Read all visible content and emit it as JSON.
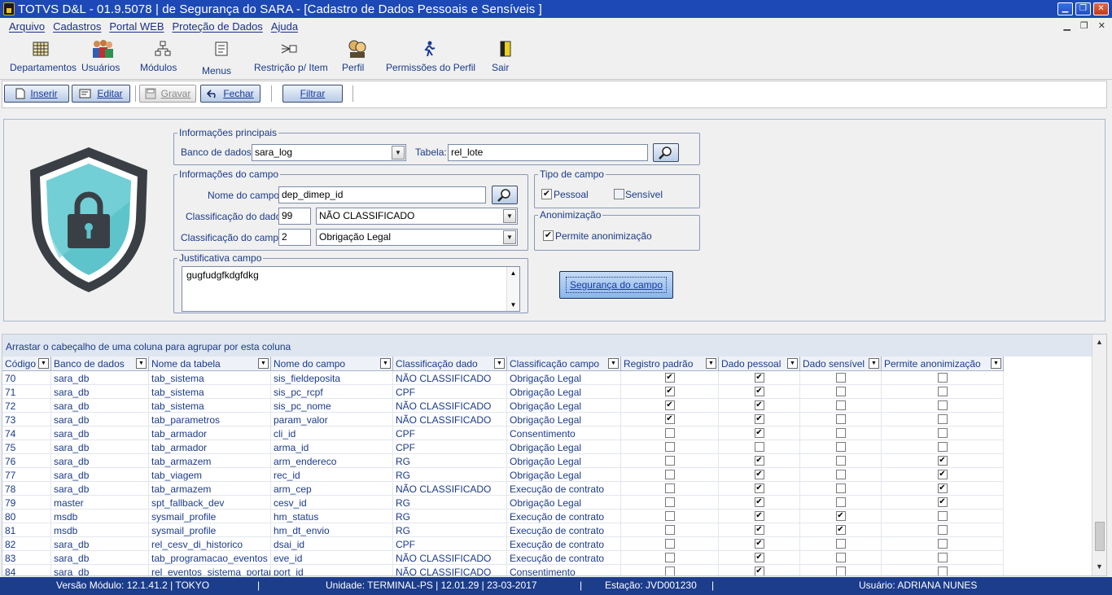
{
  "window": {
    "title": "TOTVS D&L - 01.9.5078 | de Segurança do SARA - [Cadastro de Dados Pessoais e Sensíveis ]"
  },
  "menu": [
    "Arquivo",
    "Cadastros",
    "Portal WEB",
    "Proteção de Dados",
    "Ajuda"
  ],
  "toolbar_big": [
    {
      "label": "Departamentos",
      "icon": "grid-icon"
    },
    {
      "label": "Usuários",
      "icon": "users-icon"
    },
    {
      "label": "Módulos",
      "icon": "modules-icon"
    },
    {
      "label": "Menus",
      "icon": "menus-icon"
    },
    {
      "label": "Restrição p/ Item",
      "icon": "restriction-icon"
    },
    {
      "label": "Perfil",
      "icon": "profile-icon"
    },
    {
      "label": "Permissões do Perfil",
      "icon": "permissions-icon"
    },
    {
      "label": "Sair",
      "icon": "exit-door-icon"
    }
  ],
  "actions": {
    "insert": "Inserir",
    "edit": "Editar",
    "save": "Gravar",
    "close": "Fechar",
    "filter": "Filtrar"
  },
  "form": {
    "main_group": "Informações principais",
    "db_label": "Banco de dados:",
    "db_value": "sara_log",
    "table_label": "Tabela:",
    "table_value": "rel_lote",
    "field_group": "Informações do campo",
    "field_name_label": "Nome do campo:",
    "field_name_value": "dep_dimep_id",
    "data_class_label": "Classificação do dado:",
    "data_class_code": "99",
    "data_class_value": "NÃO CLASSIFICADO",
    "field_class_label": "Classificação do campo:",
    "field_class_code": "2",
    "field_class_value": "Obrigação Legal",
    "type_group": "Tipo de campo",
    "type_personal": "Pessoal",
    "type_personal_checked": true,
    "type_sensitive": "Sensível",
    "type_sensitive_checked": false,
    "anon_group": "Anonimização",
    "anon_label": "Permite anonimização",
    "anon_checked": true,
    "justification_group": "Justificativa campo",
    "justification_value": "gugfudgfkdgfdkg",
    "security_button": "Segurança do campo"
  },
  "grid": {
    "group_hint": "Arrastar o cabeçalho de uma coluna para agrupar por esta coluna",
    "columns": [
      "Código",
      "Banco de dados",
      "Nome da tabela",
      "Nome do campo",
      "Classificação dado",
      "Classificação campo",
      "Registro padrão",
      "Dado pessoal",
      "Dado sensível",
      "Permite anonimização"
    ],
    "rows": [
      [
        "70",
        "sara_db",
        "tab_sistema",
        "sis_fieldeposita",
        "NÃO CLASSIFICADO",
        "Obrigação Legal",
        true,
        true,
        false,
        false
      ],
      [
        "71",
        "sara_db",
        "tab_sistema",
        "sis_pc_rcpf",
        "CPF",
        "Obrigação Legal",
        true,
        true,
        false,
        false
      ],
      [
        "72",
        "sara_db",
        "tab_sistema",
        "sis_pc_nome",
        "NÃO CLASSIFICADO",
        "Obrigação Legal",
        true,
        true,
        false,
        false
      ],
      [
        "73",
        "sara_db",
        "tab_parametros",
        "param_valor",
        "NÃO CLASSIFICADO",
        "Obrigação Legal",
        true,
        true,
        false,
        false
      ],
      [
        "74",
        "sara_db",
        "tab_armador",
        "cli_id",
        "CPF",
        "Consentimento",
        false,
        true,
        false,
        false
      ],
      [
        "75",
        "sara_db",
        "tab_armador",
        "arma_id",
        "CPF",
        "Obrigação Legal",
        false,
        false,
        false,
        false
      ],
      [
        "76",
        "sara_db",
        "tab_armazem",
        "arm_endereco",
        "RG",
        "Obrigação Legal",
        false,
        true,
        false,
        true
      ],
      [
        "77",
        "sara_db",
        "tab_viagem",
        "rec_id",
        "RG",
        "Obrigação Legal",
        false,
        true,
        false,
        true
      ],
      [
        "78",
        "sara_db",
        "tab_armazem",
        "arm_cep",
        "NÃO CLASSIFICADO",
        "Execução de contrato",
        false,
        true,
        false,
        true
      ],
      [
        "79",
        "master",
        "spt_fallback_dev",
        "cesv_id",
        "RG",
        "Obrigação Legal",
        false,
        true,
        false,
        true
      ],
      [
        "80",
        "msdb",
        "sysmail_profile",
        "hm_status",
        "RG",
        "Execução de contrato",
        false,
        true,
        true,
        false
      ],
      [
        "81",
        "msdb",
        "sysmail_profile",
        "hm_dt_envio",
        "RG",
        "Execução de contrato",
        false,
        true,
        true,
        false
      ],
      [
        "82",
        "sara_db",
        "rel_cesv_di_historico",
        "dsai_id",
        "CPF",
        "Execução de contrato",
        false,
        true,
        false,
        false
      ],
      [
        "83",
        "sara_db",
        "tab_programacao_eventos",
        "eve_id",
        "NÃO CLASSIFICADO",
        "Execução de contrato",
        false,
        true,
        false,
        false
      ],
      [
        "84",
        "sara_db",
        "rel_eventos_sistema_portaria",
        "port_id",
        "NÃO CLASSIFICADO",
        "Consentimento",
        false,
        true,
        false,
        false
      ]
    ]
  },
  "status": {
    "module_version": "Versão Módulo:  12.1.41.2  |  TOKYO",
    "unit": "Unidade: TERMINAL-PS | 12.01.29 | 23-03-2017",
    "station": "Estação: JVD001230",
    "user": "Usuário: ADRIANA NUNES",
    "sep": "|"
  }
}
